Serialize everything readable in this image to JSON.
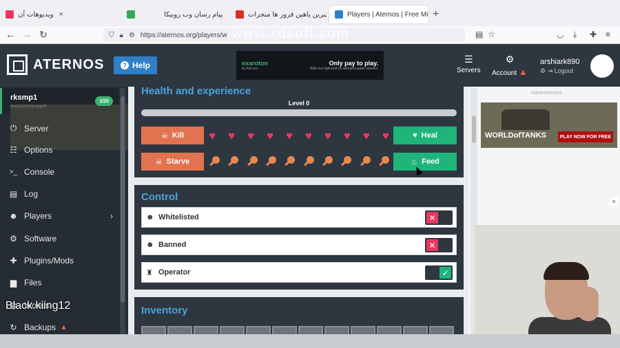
{
  "browser": {
    "tabs": [
      {
        "title": "ویدیوهات آن",
        "color": "#e8385e"
      },
      {
        "title": "",
        "color": "#34a853"
      },
      {
        "title": "پیام رسان وب روبیکا",
        "color": "#ffffff"
      },
      {
        "title": "هیچبرین یاهین فرور ها منجرات",
        "color": "#d93025"
      },
      {
        "title": "Players | Aternos | Free Minecraft",
        "color": "#2f80c9"
      }
    ],
    "url": "https://aternos.org/players/w"
  },
  "watermark": "www.zdsoft.com",
  "header": {
    "logo_text": "ATERNOS",
    "help_label": "Help",
    "ad_left": "exaroton",
    "ad_left_sub": "by Aternos",
    "ad_right": "Only pay to play.",
    "ad_right_sub": "With our high-end on demand game servers.",
    "servers_label": "Servers",
    "account_label": "Account",
    "username": "arshiark890",
    "logout_label": "Logout"
  },
  "server": {
    "name": "rksmp1",
    "address": "#5ioDQ0vhyErpg0d",
    "players": "1/20"
  },
  "sidebar": {
    "items": [
      {
        "label": "Server",
        "icon": "power-icon",
        "glyph": "⏻"
      },
      {
        "label": "Options",
        "icon": "options-icon",
        "glyph": "☷"
      },
      {
        "label": "Console",
        "icon": "console-icon",
        "glyph": ">_"
      },
      {
        "label": "Log",
        "icon": "log-icon",
        "glyph": "▤"
      },
      {
        "label": "Players",
        "icon": "players-icon",
        "glyph": "☻"
      },
      {
        "label": "Software",
        "icon": "software-icon",
        "glyph": "⚙"
      },
      {
        "label": "Plugins/Mods",
        "icon": "puzzle-icon",
        "glyph": "✚"
      },
      {
        "label": "Files",
        "icon": "folder-icon",
        "glyph": "▆"
      },
      {
        "label": "Worlds",
        "icon": "globe-icon",
        "glyph": "◍"
      },
      {
        "label": "Backups",
        "icon": "backup-icon",
        "glyph": "↻"
      }
    ]
  },
  "overlay_name": "Black.kiing12",
  "health": {
    "title": "Health and experience",
    "level": "Level 0",
    "kill_label": "Kill",
    "heal_label": "Heal",
    "starve_label": "Starve",
    "feed_label": "Feed",
    "hearts": 10,
    "food": 10
  },
  "control": {
    "title": "Control",
    "rows": [
      {
        "label": "Whitelisted",
        "enabled": false
      },
      {
        "label": "Banned",
        "enabled": false
      },
      {
        "label": "Operator",
        "enabled": true
      }
    ]
  },
  "inventory": {
    "title": "Inventory"
  },
  "right": {
    "ad_label": "Advertisement",
    "ad_game": "WORLDofTANKS",
    "ad_cta": "PLAY NOW FOR FREE"
  },
  "colors": {
    "accent": "#4aa3df",
    "orange": "#e2734f",
    "green": "#1eb57a",
    "red": "#e8385e"
  }
}
